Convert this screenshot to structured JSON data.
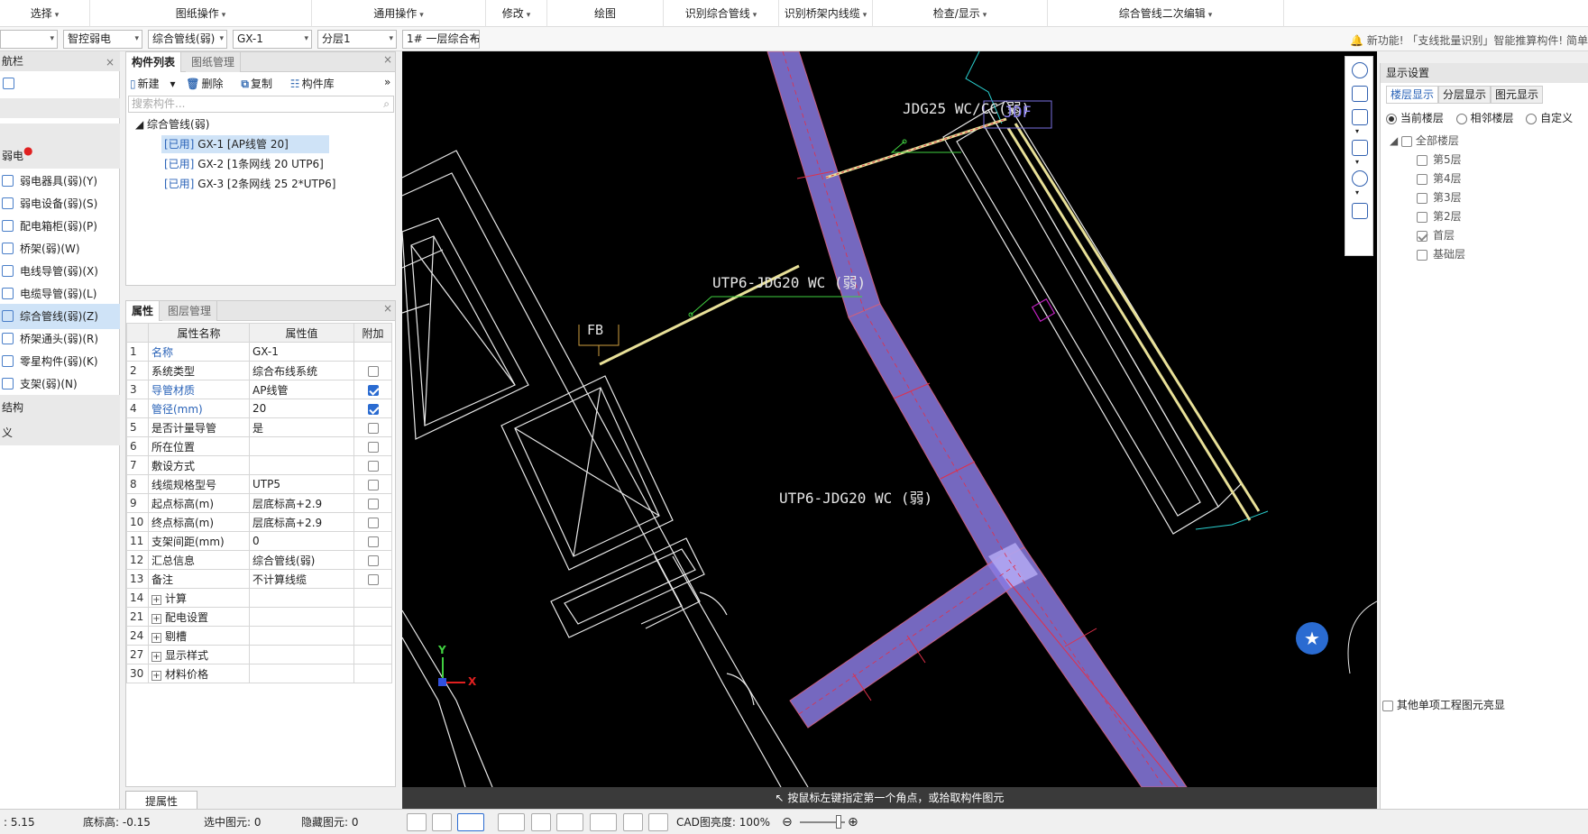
{
  "toolbar": {
    "items": [
      "选择",
      "图纸操作",
      "通用操作",
      "修改",
      "绘图",
      "识别综合管线",
      "识别桥架内线缆",
      "检查/显示",
      "综合管线二次编辑"
    ]
  },
  "toolbar2": {
    "combo1": "",
    "combo2": "智控弱电",
    "combo3": "综合管线(弱)",
    "combo4": "GX-1",
    "combo5": "分层1",
    "combo6": "1# 一层综合布",
    "notice": "新功能! 「支线批量识别」智能推算构件! 简单"
  },
  "leftnav": {
    "header": "航栏",
    "group": "弱电",
    "items": [
      "弱电器具(弱)(Y)",
      "弱电设备(弱)(S)",
      "配电箱柜(弱)(P)",
      "桥架(弱)(W)",
      "电线导管(弱)(X)",
      "电缆导管(弱)(L)",
      "综合管线(弱)(Z)",
      "桥架通头(弱)(R)",
      "零星构件(弱)(K)",
      "支架(弱)(N)"
    ],
    "group2": "结构",
    "group3": "义"
  },
  "complist": {
    "tab_active": "构件列表",
    "tab_inactive": "图纸管理",
    "new": "新建",
    "delete": "删除",
    "copy": "复制",
    "library": "构件库",
    "search_placeholder": "搜索构件...",
    "root": "综合管线(弱)",
    "items": [
      {
        "tag": "[已用]",
        "text": "GX-1 [AP线管 20]"
      },
      {
        "tag": "[已用]",
        "text": "GX-2 [1条网线 20 UTP6]"
      },
      {
        "tag": "[已用]",
        "text": "GX-3 [2条网线 25 2*UTP6]"
      }
    ]
  },
  "props": {
    "tab_active": "属性",
    "tab_inactive": "图层管理",
    "headers": [
      "属性名称",
      "属性值",
      "附加"
    ],
    "rows": [
      {
        "n": "1",
        "name": "名称",
        "val": "GX-1",
        "chk": null,
        "blue": true
      },
      {
        "n": "2",
        "name": "系统类型",
        "val": "综合布线系统",
        "chk": false,
        "blue": false
      },
      {
        "n": "3",
        "name": "导管材质",
        "val": "AP线管",
        "chk": true,
        "blue": true
      },
      {
        "n": "4",
        "name": "管径(mm)",
        "val": "20",
        "chk": true,
        "blue": true
      },
      {
        "n": "5",
        "name": "是否计量导管",
        "val": "是",
        "chk": false,
        "blue": false
      },
      {
        "n": "6",
        "name": "所在位置",
        "val": "",
        "chk": false,
        "blue": false
      },
      {
        "n": "7",
        "name": "敷设方式",
        "val": "",
        "chk": false,
        "blue": false
      },
      {
        "n": "8",
        "name": "线缆规格型号",
        "val": "UTP5",
        "chk": false,
        "blue": false
      },
      {
        "n": "9",
        "name": "起点标高(m)",
        "val": "层底标高+2.9",
        "chk": false,
        "blue": false
      },
      {
        "n": "10",
        "name": "终点标高(m)",
        "val": "层底标高+2.9",
        "chk": false,
        "blue": false
      },
      {
        "n": "11",
        "name": "支架间距(mm)",
        "val": "0",
        "chk": false,
        "blue": false
      },
      {
        "n": "12",
        "name": "汇总信息",
        "val": "综合管线(弱)",
        "chk": false,
        "blue": false
      },
      {
        "n": "13",
        "name": "备注",
        "val": "不计算线缆",
        "chk": false,
        "blue": false
      },
      {
        "n": "14",
        "name": "计算",
        "val": "",
        "chk": null,
        "blue": false,
        "exp": true
      },
      {
        "n": "21",
        "name": "配电设置",
        "val": "",
        "chk": null,
        "blue": false,
        "exp": true
      },
      {
        "n": "24",
        "name": "剔槽",
        "val": "",
        "chk": null,
        "blue": false,
        "exp": true
      },
      {
        "n": "27",
        "name": "显示样式",
        "val": "",
        "chk": null,
        "blue": false,
        "exp": true
      },
      {
        "n": "30",
        "name": "材料价格",
        "val": "",
        "chk": null,
        "blue": false,
        "exp": true
      }
    ],
    "pick_button": "提属性"
  },
  "canvas": {
    "label1": "JDG25 WC/CC(弱)",
    "label1b": "JDF",
    "label2": "UTP6-JDG20 WC (弱)",
    "label3": "UTP6-JDG20 WC (弱)",
    "label_fb": "FB",
    "axis_y": "Y",
    "axis_x": "X",
    "status": "按鼠标左键指定第一个角点，或拾取构件图元"
  },
  "display": {
    "title": "显示设置",
    "tabs": [
      "楼层显示",
      "分层显示",
      "图元显示"
    ],
    "radios": [
      "当前楼层",
      "相邻楼层",
      "自定义"
    ],
    "all_floors": "全部楼层",
    "floors": [
      "第5层",
      "第4层",
      "第3层",
      "第2层",
      "首层",
      "基础层"
    ],
    "floor_checked": [
      false,
      false,
      false,
      false,
      true,
      false
    ],
    "other": "其他单项工程图元亮显"
  },
  "status": {
    "elev": "5.15",
    "bottom_label": "底标高:",
    "bottom_val": "-0.15",
    "selected_label": "选中图元:",
    "selected_val": "0",
    "hidden_label": "隐藏图元:",
    "hidden_val": "0",
    "cad_label": "CAD图亮度:",
    "cad_val": "100%"
  }
}
